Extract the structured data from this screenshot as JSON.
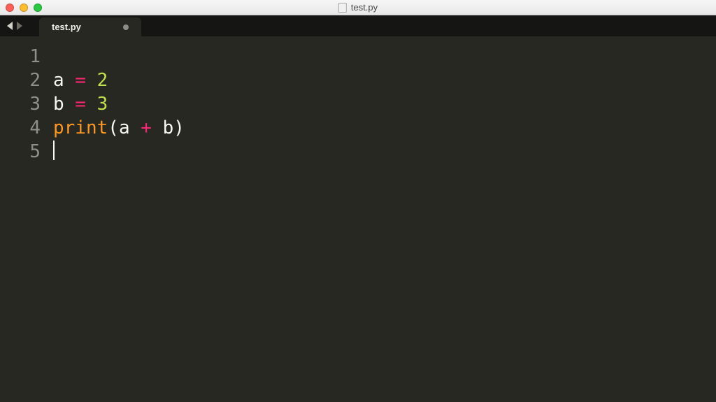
{
  "window": {
    "title": "test.py"
  },
  "tabs": {
    "active": {
      "label": "test.py",
      "dirty": true
    }
  },
  "editor": {
    "gutter": [
      "1",
      "2",
      "3",
      "4",
      "5"
    ],
    "current_line_index": 4,
    "lines": {
      "l1": {
        "raw": ""
      },
      "l2": {
        "var": "a",
        "eq": " = ",
        "num": "2"
      },
      "l3": {
        "var": "b",
        "eq": " = ",
        "num": "3"
      },
      "l4": {
        "fn": "print",
        "open": "(",
        "arg1": "a",
        "op": " + ",
        "arg2": "b",
        "close": ")"
      },
      "l5": {
        "raw": ""
      }
    }
  }
}
